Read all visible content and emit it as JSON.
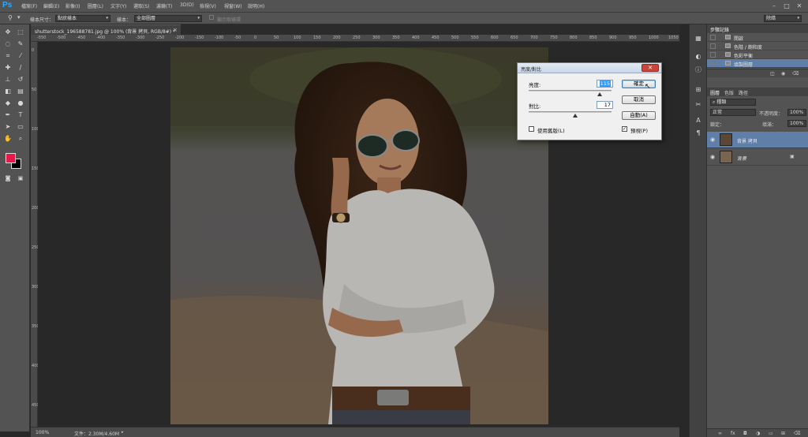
{
  "app": {
    "logo": "Ps"
  },
  "menu": [
    "檔案(F)",
    "編輯(E)",
    "影像(I)",
    "圖層(L)",
    "文字(Y)",
    "選取(S)",
    "濾鏡(T)",
    "3D(D)",
    "檢視(V)",
    "視窗(W)",
    "說明(H)"
  ],
  "window_controls": {
    "min": "–",
    "max": "□",
    "close": "✕"
  },
  "options_bar": {
    "tool_icon": "quick-selection-icon",
    "sample_size_label": "樣本尺寸：",
    "sample_size_value": "點狀樣本",
    "sample_label": "樣本：",
    "sample_value": "全部圖層",
    "show_ring_label": "顯示取樣環",
    "workspace": "除錯"
  },
  "document": {
    "tab_label": "shutterstock_196588781.jpg @ 100% (背景 拷貝, RGB/8#) *",
    "tab_close": "×",
    "zoom": "100%",
    "file_info": "文件：2.30M/4.60M"
  },
  "ruler": {
    "top_ticks": [
      "-550",
      "-500",
      "-450",
      "-400",
      "-350",
      "-300",
      "-250",
      "-200",
      "-150",
      "-100",
      "-50",
      "0",
      "50",
      "100",
      "150",
      "200",
      "250",
      "300",
      "350",
      "400",
      "450",
      "500",
      "550",
      "600",
      "650",
      "700",
      "750",
      "800",
      "850",
      "900",
      "950",
      "1000",
      "1050"
    ],
    "left_ticks": [
      "0",
      "50",
      "100",
      "150",
      "200",
      "250",
      "300",
      "350",
      "400",
      "450"
    ]
  },
  "dialog": {
    "title": "亮度/對比",
    "close": "✕",
    "brightness_label": "亮度:",
    "brightness_value": "115",
    "contrast_label": "對比:",
    "contrast_value": "17",
    "brightness_slider": 0.86,
    "contrast_slider": 0.56,
    "ok": "確定",
    "cancel": "取消",
    "auto": "自動(A)",
    "use_legacy": "使用舊版(L)",
    "use_legacy_checked": false,
    "preview": "預視(P)",
    "preview_checked": true,
    "preview_mark": "✓"
  },
  "history_panel": {
    "tabs": [
      "步驟記錄"
    ],
    "items": [
      "開啟",
      "色階 / 飽和度",
      "色彩平衡",
      "填製圖層"
    ]
  },
  "layers_panel": {
    "tabs": [
      "圖層",
      "色版",
      "路徑"
    ],
    "filter": "種類",
    "blend_mode": "正常",
    "opacity_label": "不透明度：",
    "opacity_value": "100%",
    "lock_label": "鎖定：",
    "fill_label": "填滿：",
    "fill_value": "100%",
    "layers": [
      {
        "name": "背景 拷貝",
        "selected": true,
        "visible": true
      },
      {
        "name": "背景",
        "selected": false,
        "visible": true,
        "locked": true
      }
    ],
    "eye_glyph": "◉",
    "lock_glyph": "🔒"
  },
  "tools": [
    "move-icon",
    "marquee-icon",
    "lasso-icon",
    "quick-select-icon",
    "crop-icon",
    "eyedropper-icon",
    "healing-icon",
    "brush-icon",
    "stamp-icon",
    "history-brush-icon",
    "eraser-icon",
    "gradient-icon",
    "blur-icon",
    "dodge-icon",
    "pen-icon",
    "type-icon",
    "path-select-icon",
    "shape-icon",
    "hand-icon",
    "zoom-icon"
  ],
  "colors": {
    "foreground": "#e8194a",
    "background": "#000000",
    "accent": "#31a8ff",
    "selected_layer": "#5f7ea8"
  }
}
